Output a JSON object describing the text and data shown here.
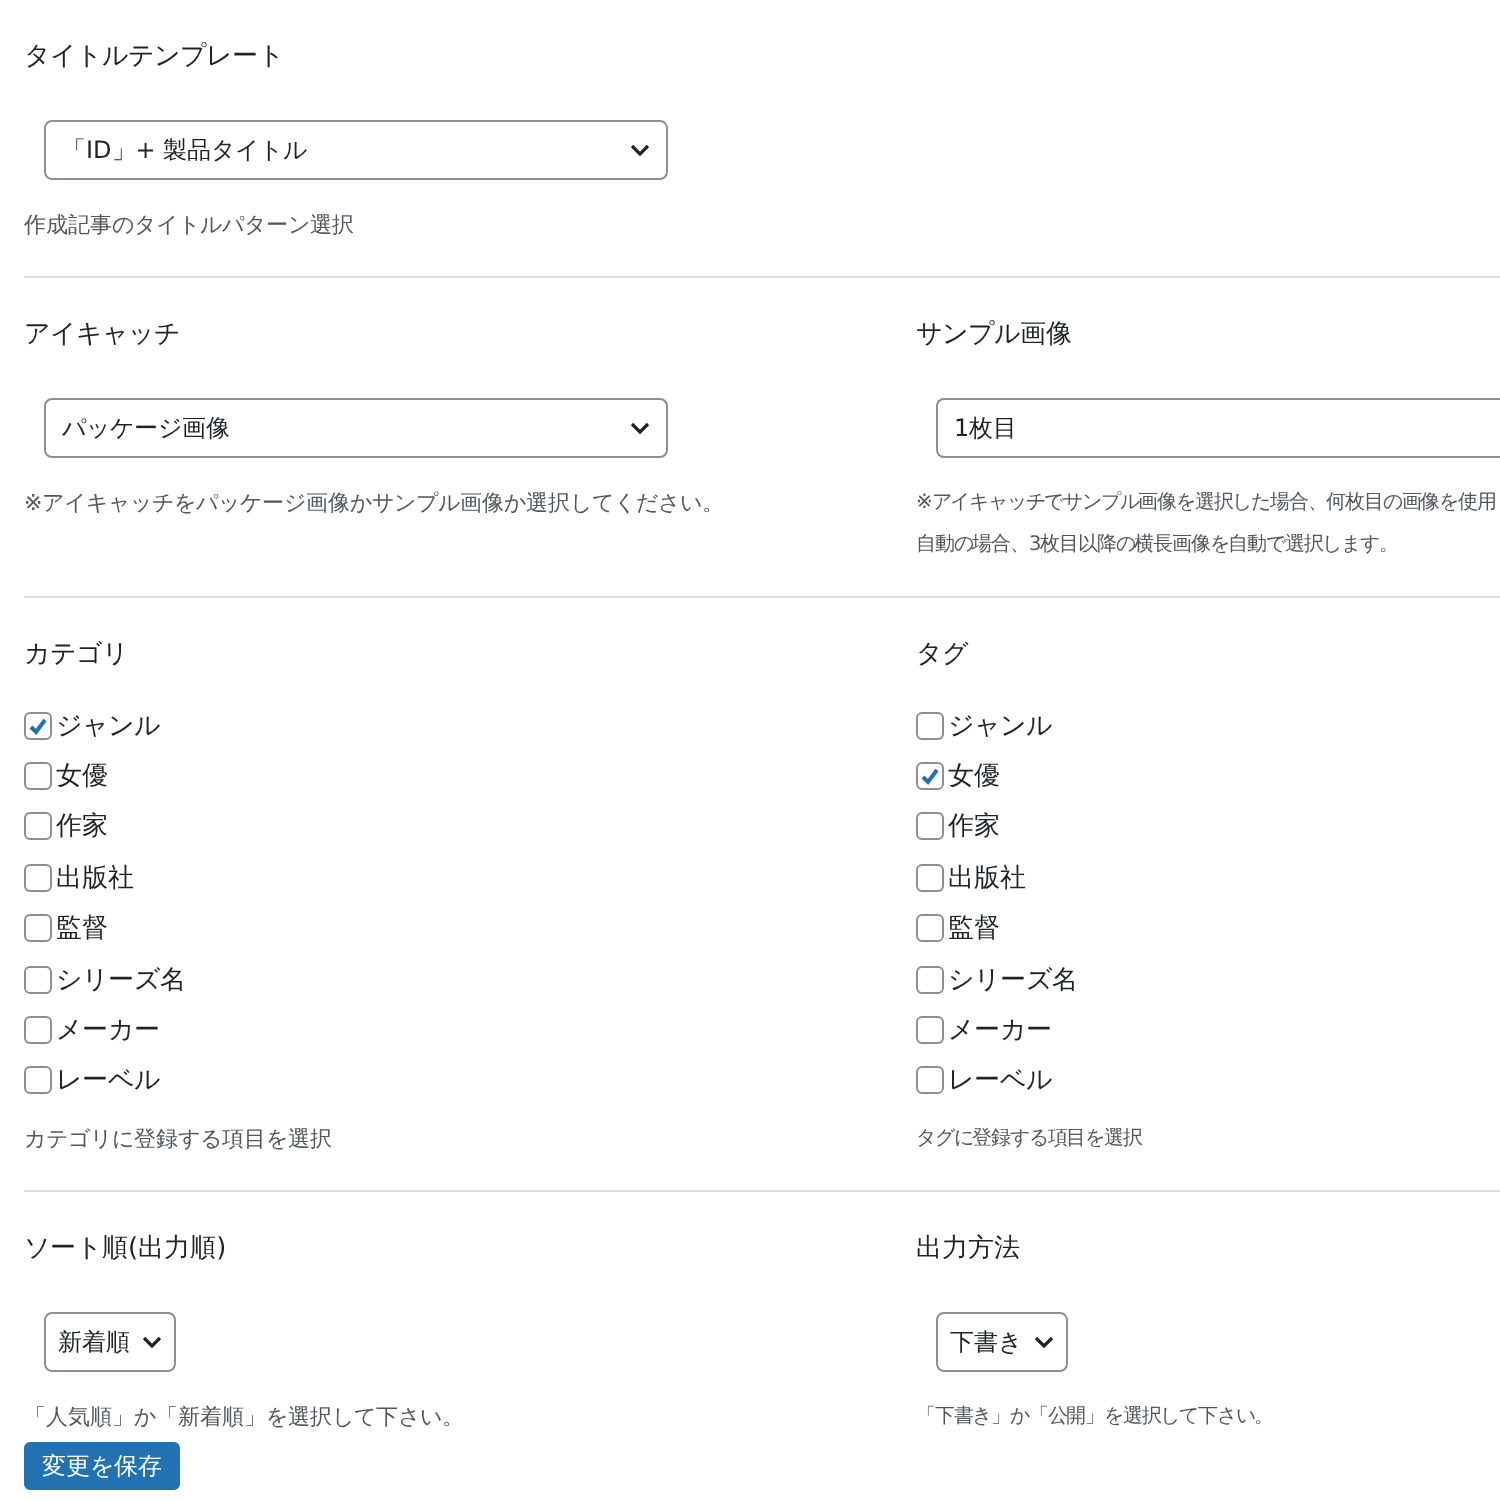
{
  "sections": [
    {
      "fields": [
        {
          "kind": "select",
          "label": "タイトルテンプレート",
          "value": "「ID」+ 製品タイトル",
          "help": [
            "作成記事のタイトルパターン選択"
          ]
        }
      ]
    },
    {
      "fields": [
        {
          "kind": "select",
          "label": "アイキャッチ",
          "value": "パッケージ画像",
          "help": [
            "※アイキャッチをパッケージ画像かサンプル画像か選択してください。"
          ]
        },
        {
          "kind": "input",
          "label": "サンプル画像",
          "value": "1枚目",
          "help": [
            "※アイキャッチでサンプル画像を選択した場合、何枚目の画像を使用",
            "自動の場合、3枚目以降の横長画像を自動で選択します。"
          ]
        }
      ]
    },
    {
      "fields": [
        {
          "kind": "checklist",
          "label": "カテゴリ",
          "options": [
            {
              "label": "ジャンル",
              "checked": true
            },
            {
              "label": "女優",
              "checked": false
            },
            {
              "label": "作家",
              "checked": false
            },
            {
              "label": "出版社",
              "checked": false
            },
            {
              "label": "監督",
              "checked": false
            },
            {
              "label": "シリーズ名",
              "checked": false
            },
            {
              "label": "メーカー",
              "checked": false
            },
            {
              "label": "レーベル",
              "checked": false
            }
          ],
          "help": [
            "カテゴリに登録する項目を選択"
          ]
        },
        {
          "kind": "checklist",
          "label": "タグ",
          "options": [
            {
              "label": "ジャンル",
              "checked": false
            },
            {
              "label": "女優",
              "checked": true
            },
            {
              "label": "作家",
              "checked": false
            },
            {
              "label": "出版社",
              "checked": false
            },
            {
              "label": "監督",
              "checked": false
            },
            {
              "label": "シリーズ名",
              "checked": false
            },
            {
              "label": "メーカー",
              "checked": false
            },
            {
              "label": "レーベル",
              "checked": false
            }
          ],
          "help": [
            "タグに登録する項目を選択"
          ]
        }
      ]
    },
    {
      "fields": [
        {
          "kind": "small-select",
          "label": "ソート順(出力順)",
          "value": "新着順",
          "help": [
            "「人気順」か「新着順」を選択して下さい。"
          ]
        },
        {
          "kind": "small-select",
          "label": "出力方法",
          "value": "下書き",
          "help": [
            "「下書き」か「公開」を選択して下さい。"
          ]
        }
      ]
    }
  ],
  "save_button": "変更を保存"
}
